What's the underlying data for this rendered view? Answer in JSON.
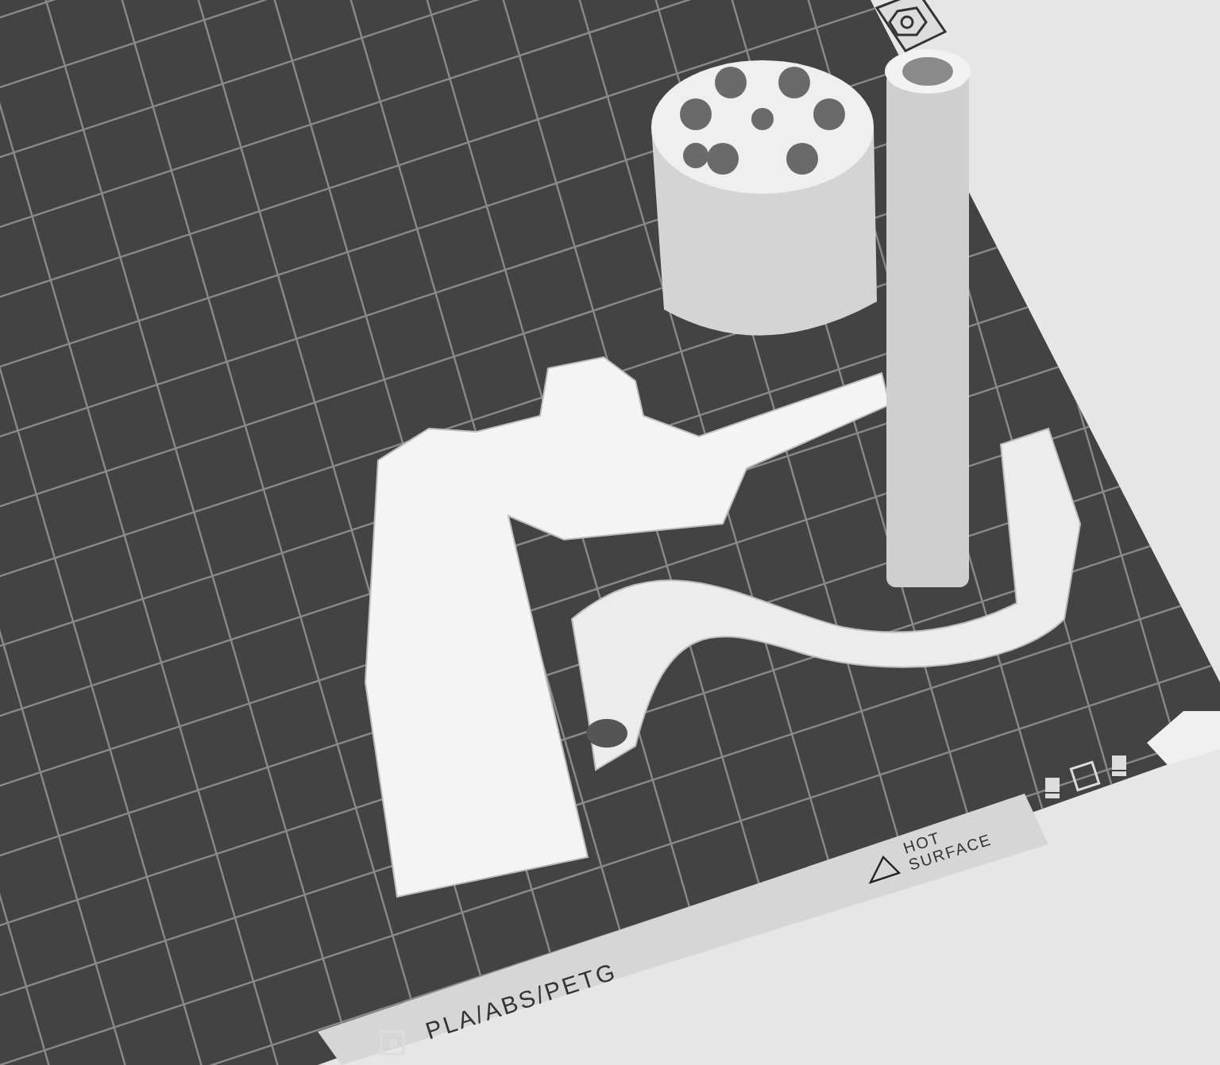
{
  "build_plate": {
    "material_label": "PLA/ABS/PETG",
    "warning_lines": [
      "HOT",
      "SURFACE"
    ]
  }
}
